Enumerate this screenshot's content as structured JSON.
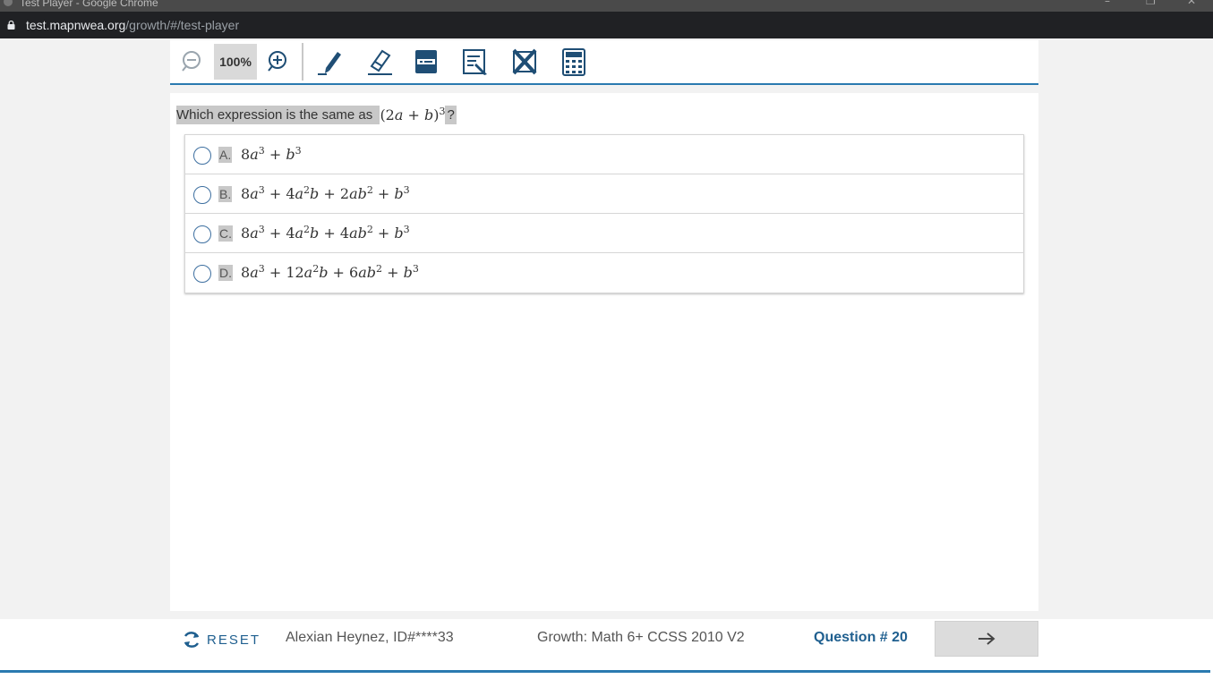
{
  "window": {
    "title": "Test Player - Google Chrome"
  },
  "address_bar": {
    "host": "test.mapnwea.org",
    "path": "/growth/#/test-player"
  },
  "toolbar": {
    "zoom_level": "100%",
    "tools": [
      "zoom-out-icon",
      "zoom-in-icon",
      "highlighter-icon",
      "eraser-icon",
      "line-reader-icon",
      "notepad-icon",
      "answer-eliminator-icon",
      "calculator-icon"
    ]
  },
  "question": {
    "prompt": "Which expression is the same as",
    "expression": {
      "pre": "(2",
      "v1": "a",
      "mid": " + ",
      "v2": "b",
      "post": ")",
      "exp": "3"
    },
    "suffix": "?"
  },
  "choices": [
    {
      "letter": "A.",
      "terms": [
        [
          "8",
          "a",
          "3"
        ],
        [
          "",
          "b",
          "3"
        ]
      ]
    },
    {
      "letter": "B.",
      "terms": [
        [
          "8",
          "a",
          "3"
        ],
        [
          "4",
          "a",
          "2",
          "b"
        ],
        [
          "2",
          "ab",
          "2"
        ],
        [
          "",
          "b",
          "3"
        ]
      ]
    },
    {
      "letter": "C.",
      "terms": [
        [
          "8",
          "a",
          "3"
        ],
        [
          "4",
          "a",
          "2",
          "b"
        ],
        [
          "4",
          "ab",
          "2"
        ],
        [
          "",
          "b",
          "3"
        ]
      ]
    },
    {
      "letter": "D.",
      "terms": [
        [
          "8",
          "a",
          "3"
        ],
        [
          "12",
          "a",
          "2",
          "b"
        ],
        [
          "6",
          "ab",
          "2"
        ],
        [
          "",
          "b",
          "3"
        ]
      ]
    }
  ],
  "footer": {
    "reset_label": "RESET",
    "student": "Alexian Heynez, ID#****33",
    "test_name": "Growth: Math 6+ CCSS 2010 V2",
    "question_number": "Question # 20"
  },
  "colors": {
    "accent": "#2a7ab0",
    "brand_text": "#1f5f8f",
    "highlight": "#c8c8c8"
  }
}
